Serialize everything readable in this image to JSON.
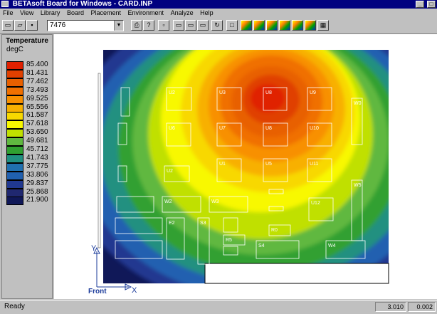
{
  "window": {
    "title": "BETAsoft Board for Windows - CARD.INP"
  },
  "menu": [
    "File",
    "View",
    "Library",
    "Board",
    "Placement",
    "Environment",
    "Analyze",
    "Help"
  ],
  "toolbar": {
    "combo_value": "7476"
  },
  "legend": {
    "title": "Temperature",
    "unit": "degC",
    "values": [
      "85.400",
      "81.431",
      "77.462",
      "73.493",
      "69.525",
      "65.556",
      "61.587",
      "57.618",
      "53.650",
      "49.681",
      "45.712",
      "41.743",
      "37.775",
      "33.806",
      "29.837",
      "25.868",
      "21.900"
    ],
    "colors": [
      "#e02000",
      "#e04000",
      "#e86000",
      "#f07000",
      "#f89000",
      "#f8b000",
      "#f8d800",
      "#f8f800",
      "#c0e000",
      "#60b840",
      "#30a030",
      "#209080",
      "#2070b0",
      "#2060b0",
      "#203890",
      "#202870",
      "#101858"
    ]
  },
  "board": {
    "components": [
      {
        "label": "U2"
      },
      {
        "label": "U3"
      },
      {
        "label": "U8"
      },
      {
        "label": "U9"
      },
      {
        "label": "W0"
      },
      {
        "label": "U6"
      },
      {
        "label": "U7"
      },
      {
        "label": "U8"
      },
      {
        "label": "U10"
      },
      {
        "label": "U1"
      },
      {
        "label": "U5"
      },
      {
        "label": "U11"
      },
      {
        "label": "U2"
      },
      {
        "label": "W5"
      },
      {
        "label": "W2"
      },
      {
        "label": "W3"
      },
      {
        "label": "U12"
      },
      {
        "label": "E2"
      },
      {
        "label": "S3"
      },
      {
        "label": "R0"
      },
      {
        "label": "R5"
      },
      {
        "label": "S4"
      },
      {
        "label": "W4"
      }
    ],
    "axes": {
      "y": "Y",
      "x": "X",
      "front": "Front"
    }
  },
  "status": {
    "text": "Ready",
    "field1": "3.010",
    "field2": "0.002"
  }
}
